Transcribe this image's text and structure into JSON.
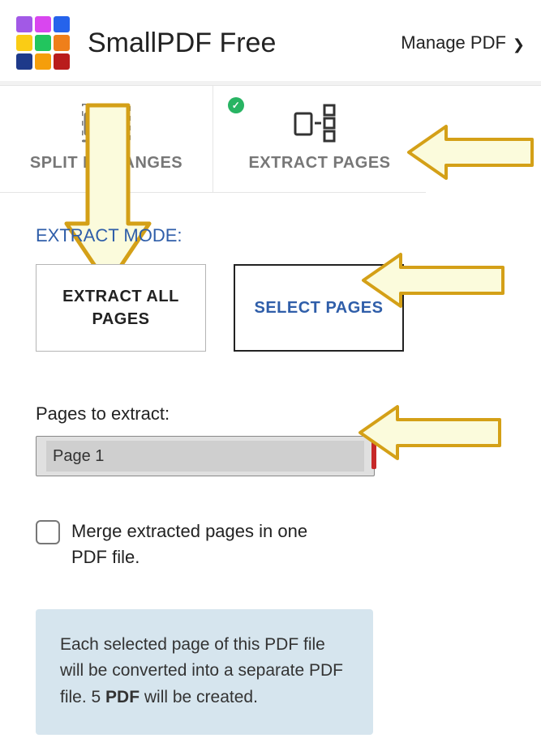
{
  "header": {
    "title": "SmallPDF Free",
    "menu": "Manage PDF"
  },
  "tabs": {
    "split": "SPLIT BY RANGES",
    "extract": "EXTRACT PAGES"
  },
  "section": {
    "modeLabel": "EXTRACT MODE:",
    "extractAll": "EXTRACT ALL PAGES",
    "selectPages": "SELECT PAGES"
  },
  "pagesField": {
    "label": "Pages to extract:",
    "value": "Page 1"
  },
  "merge": {
    "label": "Merge extracted pages in one PDF file."
  },
  "info": {
    "pre": "Each selected page of this PDF file will be converted into a separate PDF file. 5 ",
    "bold": "PDF",
    "post": " will be created."
  }
}
